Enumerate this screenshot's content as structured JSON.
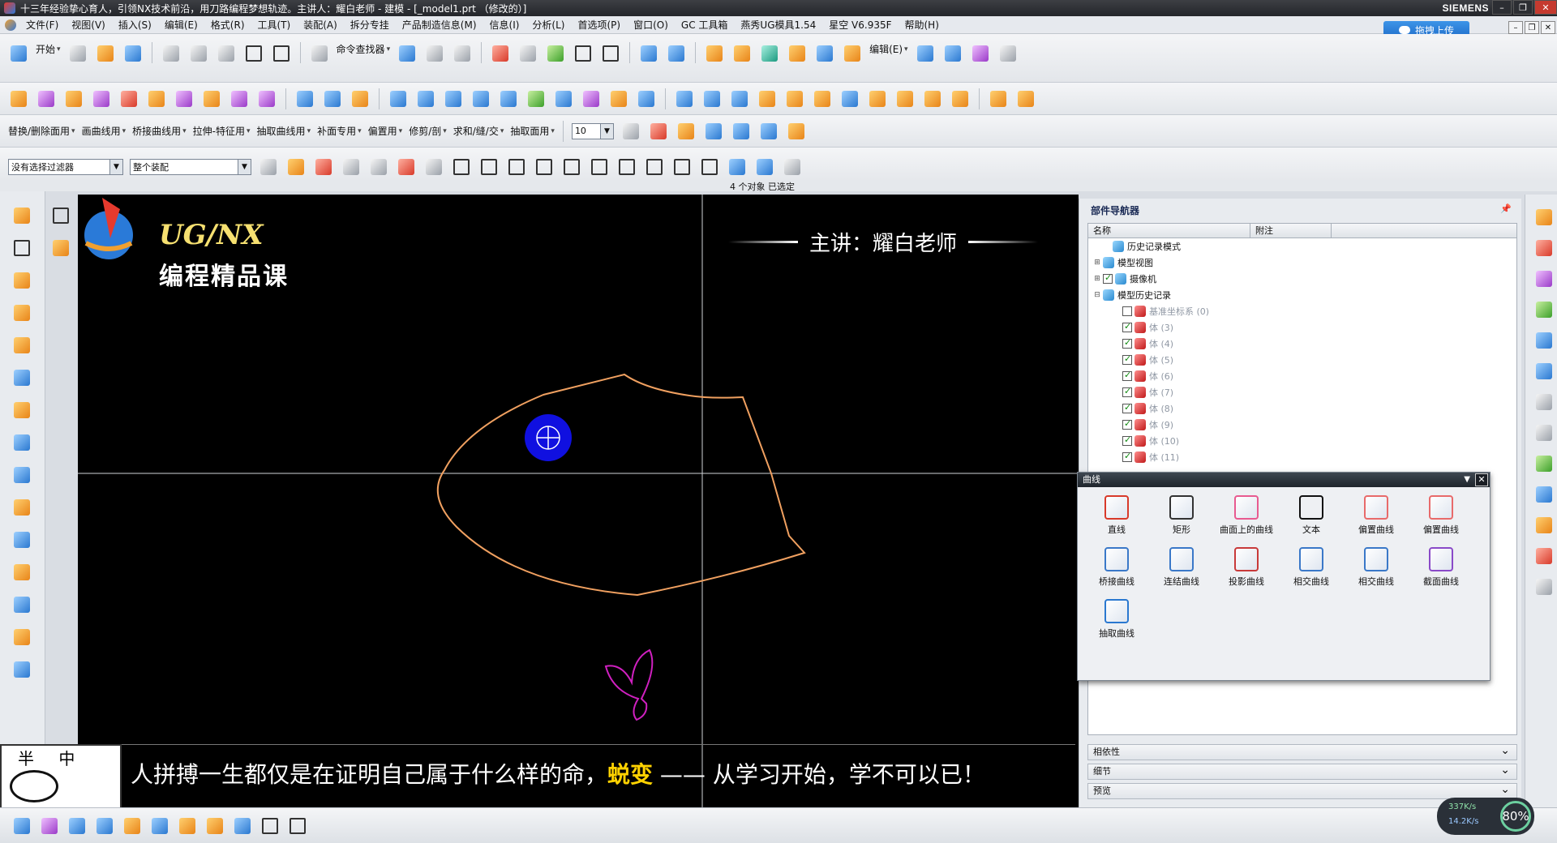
{
  "titlebar": {
    "title": "十三年经验挚心育人，引领NX技术前沿，用刀路编程梦想轨迹。主讲人：耀白老师 - 建模 - [_model1.prt （修改的）]",
    "brand": "SIEMENS"
  },
  "menubar": {
    "items": [
      "文件(F)",
      "视图(V)",
      "插入(S)",
      "编辑(E)",
      "格式(R)",
      "工具(T)",
      "装配(A)",
      "拆分专挂",
      "产品制造信息(M)",
      "信息(I)",
      "分析(L)",
      "首选项(P)",
      "窗口(O)",
      "GC 工具箱",
      "燕秀UG模具1.54",
      "星空 V6.935F",
      "帮助(H)"
    ],
    "upload_label": "拖拽上传"
  },
  "toolbar1": {
    "start_label": "开始",
    "cmd_finder_label": "命令查找器",
    "edit_label": "编辑(E)"
  },
  "toolbar3": {
    "groups": [
      "替换/删除面用",
      "画曲线用",
      "桥接曲线用",
      "拉伸-特征用",
      "抽取曲线用",
      "补面专用",
      "偏置用",
      "修剪/剖",
      "求和/缝/交",
      "抽取面用"
    ],
    "number": "10"
  },
  "toolbar4": {
    "filter": "没有选择过滤器",
    "scope": "整个装配"
  },
  "status": "4 个对象 已选定",
  "viewport": {
    "logo_title": "UG/NX",
    "logo_subtitle": "编程精品课",
    "lecturer": "主讲：耀白老师",
    "subtitle_pre": "人拼搏一生都仅是在证明自己属于什么样的命，",
    "subtitle_highlight": "蜕变",
    "subtitle_post": " —— 从学习开始，学不可以已！",
    "watermark": "半 中"
  },
  "navigator": {
    "title": "部件导航器",
    "col_name": "名称",
    "col_note": "附注",
    "rows": [
      {
        "label": "历史记录模式",
        "indent": 1,
        "exp": "",
        "check": "none"
      },
      {
        "label": "模型视图",
        "indent": 0,
        "exp": "+",
        "check": "none"
      },
      {
        "label": "摄像机",
        "indent": 0,
        "exp": "+",
        "check": "on"
      },
      {
        "label": "模型历史记录",
        "indent": 0,
        "exp": "−",
        "check": "none"
      },
      {
        "label": "基准坐标系 (0)",
        "indent": 2,
        "exp": "",
        "check": "off",
        "dim": true
      },
      {
        "label": "体 (3)",
        "indent": 2,
        "exp": "",
        "check": "on",
        "dim": true
      },
      {
        "label": "体 (4)",
        "indent": 2,
        "exp": "",
        "check": "on",
        "dim": true
      },
      {
        "label": "体 (5)",
        "indent": 2,
        "exp": "",
        "check": "on",
        "dim": true
      },
      {
        "label": "体 (6)",
        "indent": 2,
        "exp": "",
        "check": "on",
        "dim": true
      },
      {
        "label": "体 (7)",
        "indent": 2,
        "exp": "",
        "check": "on",
        "dim": true
      },
      {
        "label": "体 (8)",
        "indent": 2,
        "exp": "",
        "check": "on",
        "dim": true
      },
      {
        "label": "体 (9)",
        "indent": 2,
        "exp": "",
        "check": "on",
        "dim": true
      },
      {
        "label": "体 (10)",
        "indent": 2,
        "exp": "",
        "check": "on",
        "dim": true
      },
      {
        "label": "体 (11)",
        "indent": 2,
        "exp": "",
        "check": "on",
        "dim": true
      }
    ],
    "panels": [
      "相依性",
      "细节",
      "预览"
    ]
  },
  "curve_dialog": {
    "title": "曲线",
    "commands": [
      {
        "label": "直线",
        "icon": "line-icon"
      },
      {
        "label": "矩形",
        "icon": "rectangle-icon"
      },
      {
        "label": "曲面上的曲线",
        "icon": "curve-on-surface-icon"
      },
      {
        "label": "文本",
        "icon": "text-icon"
      },
      {
        "label": "偏置曲线",
        "icon": "offset-curve-icon"
      },
      {
        "label": "偏置曲线",
        "icon": "offset-curve-icon"
      },
      {
        "label": "桥接曲线",
        "icon": "bridge-curve-icon"
      },
      {
        "label": "连结曲线",
        "icon": "join-curve-icon"
      },
      {
        "label": "投影曲线",
        "icon": "project-curve-icon"
      },
      {
        "label": "相交曲线",
        "icon": "intersect-curve-icon"
      },
      {
        "label": "相交曲线",
        "icon": "intersect-curve-icon"
      },
      {
        "label": "截面曲线",
        "icon": "section-curve-icon"
      },
      {
        "label": "抽取曲线",
        "icon": "extract-curve-icon"
      }
    ]
  },
  "netspeed": {
    "up": "337K/s",
    "down": "14.2K/s",
    "percent": "80%"
  },
  "colors": {
    "curve": "#f0a060",
    "selection": "#1010e0",
    "viewport_bg": "#000000"
  }
}
